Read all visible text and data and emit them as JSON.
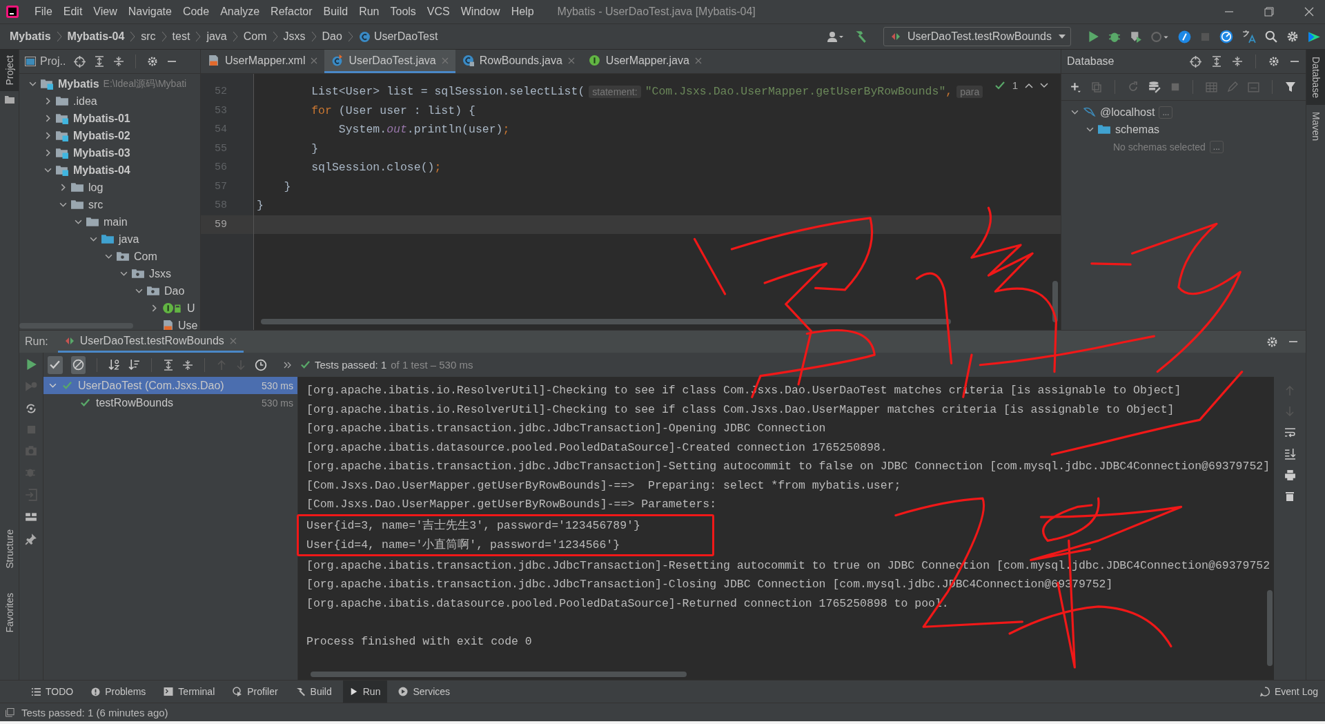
{
  "menu": [
    "File",
    "Edit",
    "View",
    "Navigate",
    "Code",
    "Analyze",
    "Refactor",
    "Build",
    "Run",
    "Tools",
    "VCS",
    "Window",
    "Help"
  ],
  "window_title": "Mybatis - UserDaoTest.java [Mybatis-04]",
  "breadcrumbs": [
    {
      "label": "Mybatis",
      "kind": "module"
    },
    {
      "label": "Mybatis-04",
      "kind": "module"
    },
    {
      "label": "src",
      "kind": "dir"
    },
    {
      "label": "test",
      "kind": "dir"
    },
    {
      "label": "java",
      "kind": "dir"
    },
    {
      "label": "Com",
      "kind": "dir"
    },
    {
      "label": "Jsxs",
      "kind": "dir"
    },
    {
      "label": "Dao",
      "kind": "dir"
    },
    {
      "label": "UserDaoTest",
      "kind": "class"
    }
  ],
  "run_config": "UserDaoTest.testRowBounds",
  "left_stripe": {
    "top": [
      {
        "label": "Project",
        "selected": true
      }
    ],
    "bottom": [
      {
        "label": "Structure",
        "selected": false
      },
      {
        "label": "Favorites",
        "selected": false
      }
    ]
  },
  "right_stripe": [
    {
      "label": "Database",
      "selected": true
    },
    {
      "label": "Maven",
      "selected": false
    }
  ],
  "project": {
    "title": "Proj..",
    "tree": [
      {
        "label": "Mybatis",
        "kind": "module",
        "note": "E:\\Ideal源码\\Mybati",
        "expanded": true,
        "children": [
          {
            "label": ".idea",
            "kind": "folder",
            "expanded": false
          },
          {
            "label": "Mybatis-01",
            "kind": "module",
            "expanded": false
          },
          {
            "label": "Mybatis-02",
            "kind": "module",
            "expanded": false
          },
          {
            "label": "Mybatis-03",
            "kind": "module",
            "expanded": false
          },
          {
            "label": "Mybatis-04",
            "kind": "module",
            "expanded": true,
            "children": [
              {
                "label": "log",
                "kind": "folder",
                "expanded": false
              },
              {
                "label": "src",
                "kind": "folder",
                "expanded": true,
                "children": [
                  {
                    "label": "main",
                    "kind": "folder",
                    "expanded": true,
                    "children": [
                      {
                        "label": "java",
                        "kind": "source",
                        "expanded": true,
                        "children": [
                          {
                            "label": "Com",
                            "kind": "package",
                            "expanded": true,
                            "children": [
                              {
                                "label": "Jsxs",
                                "kind": "package",
                                "expanded": true,
                                "children": [
                                  {
                                    "label": "Dao",
                                    "kind": "package",
                                    "expanded": true,
                                    "children": [
                                      {
                                        "label": "U",
                                        "kind": "interface",
                                        "expanded": false
                                      },
                                      {
                                        "label": "Use",
                                        "kind": "xml"
                                      }
                                    ]
                                  }
                                ]
                              }
                            ]
                          }
                        ]
                      }
                    ]
                  }
                ]
              }
            ]
          }
        ]
      }
    ]
  },
  "editor_tabs": [
    {
      "label": "UserMapper.xml",
      "kind": "xml",
      "selected": false
    },
    {
      "label": "UserDaoTest.java",
      "kind": "test",
      "selected": true
    },
    {
      "label": "RowBounds.java",
      "kind": "class",
      "selected": false
    },
    {
      "label": "UserMapper.java",
      "kind": "interface",
      "selected": false
    }
  ],
  "editor": {
    "inspections": "1",
    "lines": [
      {
        "number": "52",
        "current": false,
        "tokens": [
          {
            "text": "        List<User> list = sqlSession.selectList(",
            "kind": "plain"
          },
          {
            "text": "statement:",
            "kind": "hint"
          },
          {
            "text": "\"Com.Jsxs.Dao.UserMapper.getUserByRowBounds\"",
            "kind": "string"
          },
          {
            "text": ",",
            "kind": "punct"
          },
          {
            "text": "para",
            "kind": "hint"
          }
        ]
      },
      {
        "number": "53",
        "current": false,
        "tokens": [
          {
            "text": "        for",
            "kind": "keyword"
          },
          {
            "text": " (User user : list) {",
            "kind": "plain"
          }
        ]
      },
      {
        "number": "54",
        "current": false,
        "tokens": [
          {
            "text": "            System.",
            "kind": "plain"
          },
          {
            "text": "out",
            "kind": "static"
          },
          {
            "text": ".println(user)",
            "kind": "plain"
          },
          {
            "text": ";",
            "kind": "punct"
          }
        ]
      },
      {
        "number": "55",
        "current": false,
        "tokens": [
          {
            "text": "        }",
            "kind": "plain"
          }
        ]
      },
      {
        "number": "56",
        "current": false,
        "tokens": [
          {
            "text": "        sqlSession.close()",
            "kind": "plain"
          },
          {
            "text": ";",
            "kind": "punct"
          }
        ]
      },
      {
        "number": "57",
        "current": false,
        "tokens": [
          {
            "text": "    }",
            "kind": "plain"
          }
        ]
      },
      {
        "number": "58",
        "current": false,
        "tokens": [
          {
            "text": "}",
            "kind": "plain"
          }
        ]
      },
      {
        "number": "59",
        "current": true
      }
    ]
  },
  "database": {
    "title": "Database",
    "tree": [
      {
        "label": "@localhost",
        "kind": "host",
        "more": "...",
        "expanded": true,
        "children": [
          {
            "label": "schemas",
            "kind": "folder",
            "expanded": true,
            "children": [
              {
                "label": "No schemas selected",
                "kind": "note",
                "more": "..."
              }
            ]
          }
        ]
      }
    ]
  },
  "run": {
    "label": "Run:",
    "tab": "UserDaoTest.testRowBounds",
    "toggles": [
      {
        "kind": "passed",
        "on": true
      },
      {
        "kind": "ignored",
        "on": true
      }
    ],
    "status": {
      "label": "Tests passed: 1",
      "detail": "of 1 test – 530 ms"
    },
    "tests": [
      {
        "label": "UserDaoTest (Com.Jsxs.Dao)",
        "time": "530 ms",
        "selected": true,
        "expanded": true,
        "children": [
          {
            "label": "testRowBounds",
            "time": "530 ms",
            "selected": false
          }
        ]
      }
    ],
    "console": [
      {
        "boxed": false,
        "lines": [
          "[org.apache.ibatis.io.ResolverUtil]-Checking to see if class Com.Jsxs.Dao.UserDaoTest matches criteria [is assignable to Object]",
          "[org.apache.ibatis.io.ResolverUtil]-Checking to see if class Com.Jsxs.Dao.UserMapper matches criteria [is assignable to Object]",
          "[org.apache.ibatis.transaction.jdbc.JdbcTransaction]-Opening JDBC Connection",
          "[org.apache.ibatis.datasource.pooled.PooledDataSource]-Created connection 1765250898.",
          "[org.apache.ibatis.transaction.jdbc.JdbcTransaction]-Setting autocommit to false on JDBC Connection [com.mysql.jdbc.JDBC4Connection@69379752]",
          "[Com.Jsxs.Dao.UserMapper.getUserByRowBounds]-==>  Preparing: select *from mybatis.user;",
          "[Com.Jsxs.Dao.UserMapper.getUserByRowBounds]-==> Parameters:"
        ]
      },
      {
        "boxed": true,
        "lines": [
          "User{id=3, name='吉士先生3', password='123456789'}",
          "User{id=4, name='小直筒啊', password='1234566'}"
        ]
      },
      {
        "boxed": false,
        "lines": [
          "[org.apache.ibatis.transaction.jdbc.JdbcTransaction]-Resetting autocommit to true on JDBC Connection [com.mysql.jdbc.JDBC4Connection@69379752",
          "[org.apache.ibatis.transaction.jdbc.JdbcTransaction]-Closing JDBC Connection [com.mysql.jdbc.JDBC4Connection@69379752]",
          "[org.apache.ibatis.datasource.pooled.PooledDataSource]-Returned connection 1765250898 to pool."
        ]
      },
      {
        "boxed": false,
        "lines": [
          "Process finished with exit code 0"
        ]
      }
    ]
  },
  "tool_buttons": [
    {
      "label": "TODO",
      "kind": "todo",
      "selected": false
    },
    {
      "label": "Problems",
      "kind": "problems",
      "selected": false
    },
    {
      "label": "Terminal",
      "kind": "terminal",
      "selected": false
    },
    {
      "label": "Profiler",
      "kind": "profiler",
      "selected": false
    },
    {
      "label": "Build",
      "kind": "build",
      "selected": false
    },
    {
      "label": "Run",
      "kind": "run",
      "selected": true
    },
    {
      "label": "Services",
      "kind": "services",
      "selected": false
    }
  ],
  "event_log": "Event Log",
  "status_bar": "Tests passed: 1 (6 minutes ago)"
}
